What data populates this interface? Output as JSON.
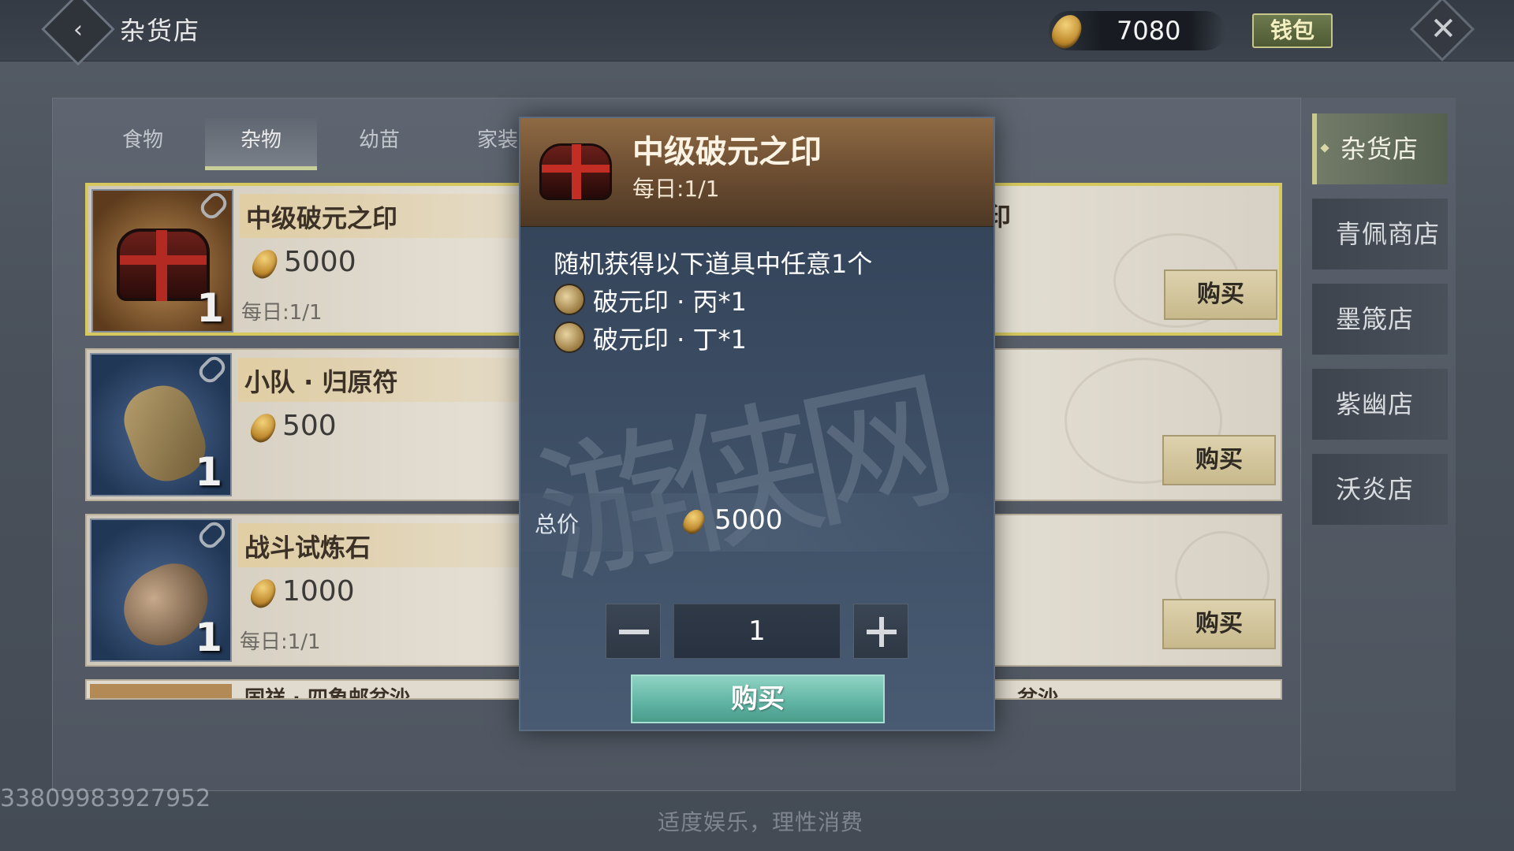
{
  "header": {
    "title": "杂货店",
    "currency_amount": "7080",
    "wallet_label": "钱包"
  },
  "tabs": [
    {
      "label": "食物",
      "active": false
    },
    {
      "label": "杂物",
      "active": true
    },
    {
      "label": "幼苗",
      "active": false
    },
    {
      "label": "家装",
      "active": false
    }
  ],
  "items": [
    {
      "name": "中级破元之印",
      "price": "5000",
      "quantity": "1",
      "limit": "每日:1/1",
      "right_fragment": "印",
      "buy_label": "购买",
      "icon": "chest-icon"
    },
    {
      "name": "小队 · 归原符",
      "price": "500",
      "quantity": "1",
      "limit": "",
      "buy_label": "购买",
      "icon": "scroll-icon"
    },
    {
      "name": "战斗试炼石",
      "price": "1000",
      "quantity": "1",
      "limit": "每日:1/1",
      "buy_label": "购买",
      "icon": "stone-icon"
    },
    {
      "name": "国祥 · 四象邮盆沙",
      "right_fragment": "盆沙"
    }
  ],
  "side_shops": [
    {
      "label": "杂货店",
      "active": true
    },
    {
      "label": "青佩商店",
      "active": false
    },
    {
      "label": "墨箴店",
      "active": false
    },
    {
      "label": "紫幽店",
      "active": false
    },
    {
      "label": "沃炎店",
      "active": false
    }
  ],
  "popup": {
    "title": "中级破元之印",
    "limit": "每日:1/1",
    "description": "随机获得以下道具中任意1个",
    "rewards": [
      {
        "text": "破元印 · 丙*1",
        "icon": "seal-bing-icon"
      },
      {
        "text": "破元印 · 丁*1",
        "icon": "seal-ding-icon"
      }
    ],
    "total_label": "总价",
    "total_value": "5000",
    "quantity": "1",
    "buy_label": "购买",
    "watermark": "游侠网"
  },
  "footer": {
    "id_text": "33809983927952",
    "notice": "适度娱乐，理性消费"
  },
  "colors": {
    "accent_teal": "#5fb3a2",
    "selected_border": "#d7c85d",
    "popup_header": "#6d4e32"
  }
}
